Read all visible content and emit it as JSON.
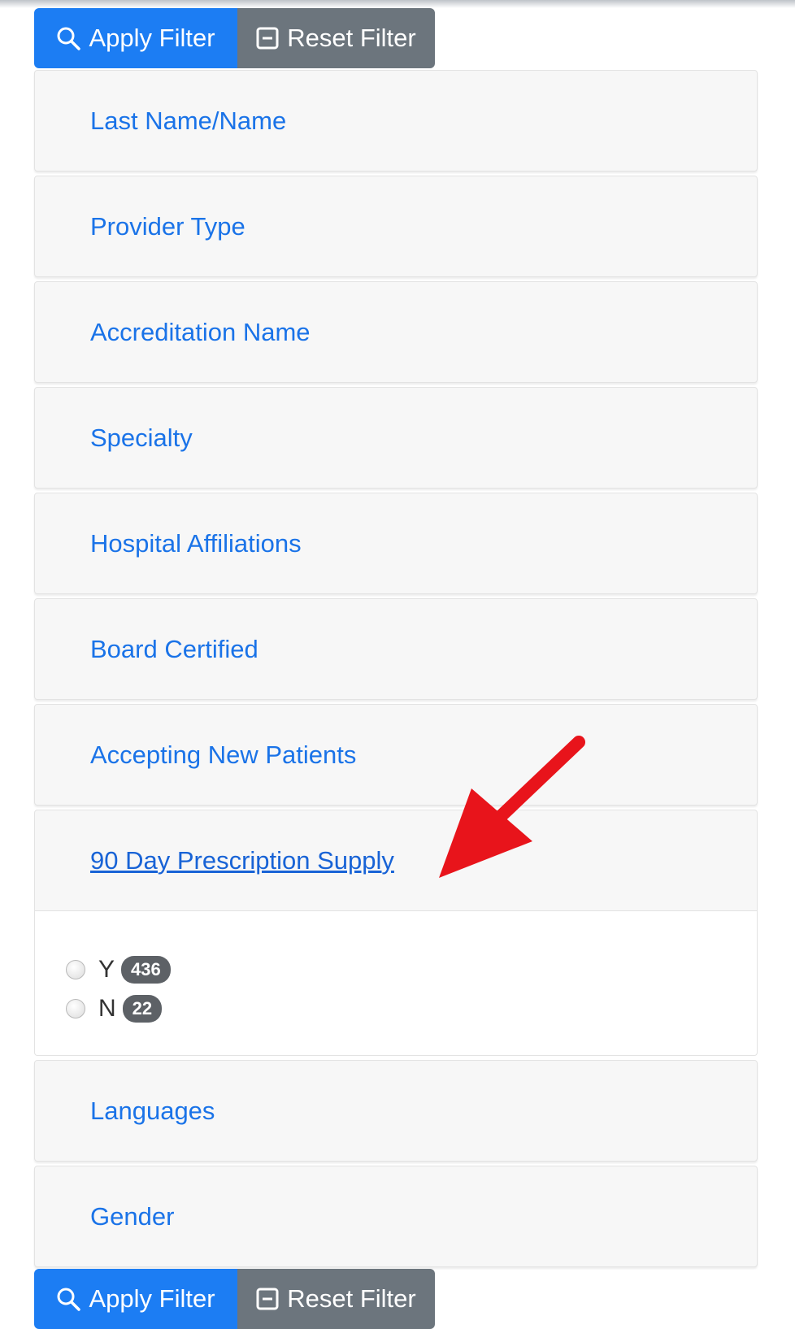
{
  "toolbar": {
    "apply_label": "Apply Filter",
    "reset_label": "Reset Filter",
    "apply_icon": "search-icon",
    "reset_icon": "minus-square-icon"
  },
  "filters": [
    {
      "label": "Last Name/Name"
    },
    {
      "label": "Provider Type"
    },
    {
      "label": "Accreditation Name"
    },
    {
      "label": "Specialty"
    },
    {
      "label": "Hospital Affiliations"
    },
    {
      "label": "Board Certified"
    },
    {
      "label": "Accepting New Patients"
    },
    {
      "label": "90 Day Prescription Supply",
      "expanded": true,
      "options": [
        {
          "label": "Y",
          "count": "436"
        },
        {
          "label": "N",
          "count": "22"
        }
      ]
    },
    {
      "label": "Languages"
    },
    {
      "label": "Gender"
    }
  ],
  "colors": {
    "primary": "#1c7df3",
    "secondary": "#6c757d",
    "link": "#1a73e8",
    "badge": "#5d6166",
    "annotation_arrow": "#e8141b"
  }
}
